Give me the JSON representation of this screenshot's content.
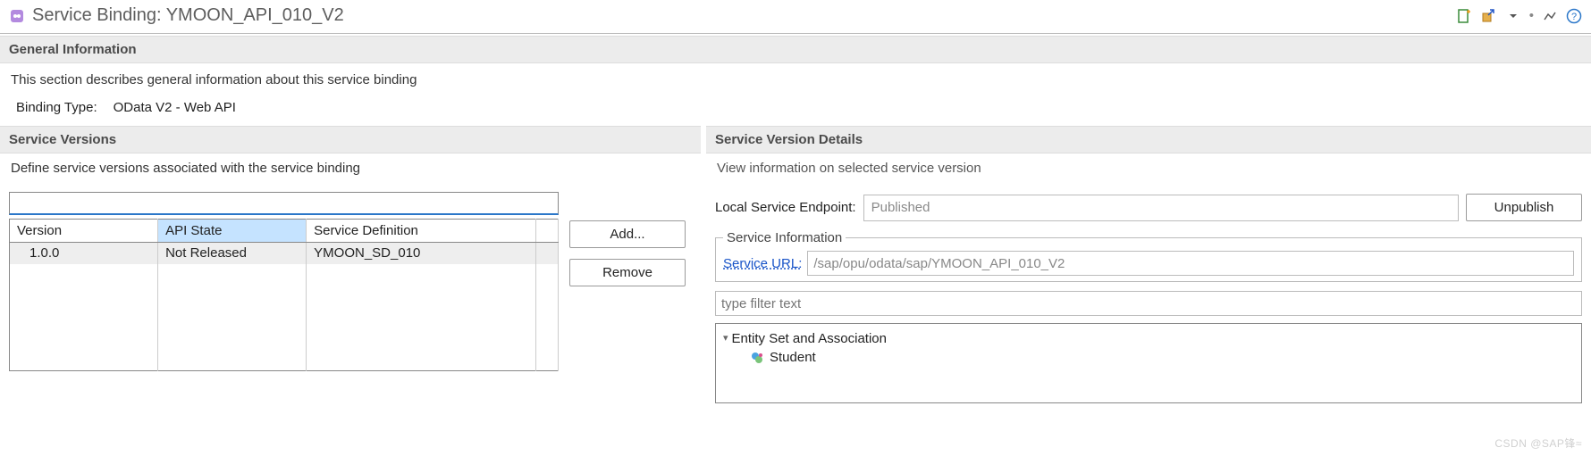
{
  "header": {
    "title": "Service Binding: YMOON_API_010_V2"
  },
  "general": {
    "section_title": "General Information",
    "description": "This section describes general information about this service binding",
    "binding_type_label": "Binding Type:",
    "binding_type_value": "OData V2 - Web API"
  },
  "versions_panel": {
    "section_title": "Service Versions",
    "description": "Define service versions associated with the service binding",
    "filter_value": "",
    "columns": {
      "version": "Version",
      "api_state": "API State",
      "service_definition": "Service Definition"
    },
    "rows": [
      {
        "version": "1.0.0",
        "api_state": "Not Released",
        "service_definition": "YMOON_SD_010"
      }
    ],
    "buttons": {
      "add": "Add...",
      "remove": "Remove"
    }
  },
  "details_panel": {
    "section_title": "Service Version Details",
    "description": "View information on selected service version",
    "endpoint_label": "Local Service Endpoint:",
    "endpoint_value": "Published",
    "unpublish_label": "Unpublish",
    "service_info_legend": "Service Information",
    "service_url_label": "Service URL:",
    "service_url_value": "/sap/opu/odata/sap/YMOON_API_010_V2",
    "type_filter_placeholder": "type filter text",
    "entity_root": "Entity Set and Association",
    "entities": [
      "Student"
    ]
  },
  "watermark": "CSDN @SAP锋≈"
}
